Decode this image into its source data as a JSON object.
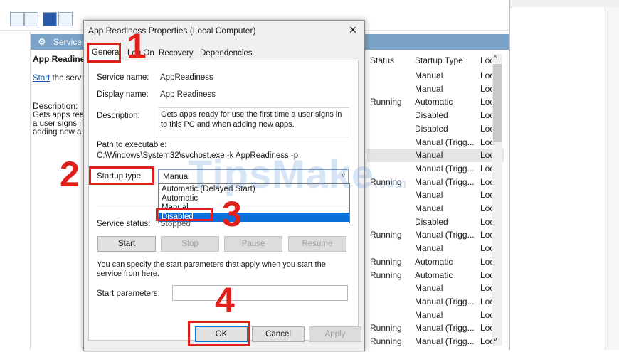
{
  "services_window": {
    "header_title": "Service",
    "service_name": "App Readine",
    "start_link": "Start",
    "start_rest": " the serv",
    "description_label": "Description:",
    "description_lines": [
      "Gets apps rea",
      "a user signs i",
      "adding new a"
    ],
    "columns": {
      "status": "Status",
      "startup": "Startup Type",
      "log": "Loc"
    },
    "rows": [
      {
        "status": "",
        "startup": "Manual",
        "log": "Loc"
      },
      {
        "status": "",
        "startup": "Manual",
        "log": "Loc"
      },
      {
        "status": "Running",
        "startup": "Automatic",
        "log": "Loc"
      },
      {
        "status": "",
        "startup": "Disabled",
        "log": "Loc"
      },
      {
        "status": "",
        "startup": "Disabled",
        "log": "Loc"
      },
      {
        "status": "",
        "startup": "Manual (Trigg...",
        "log": "Loc"
      },
      {
        "status": "",
        "startup": "Manual",
        "log": "Loc",
        "selected": true
      },
      {
        "status": "",
        "startup": "Manual (Trigg...",
        "log": "Loc"
      },
      {
        "status": "Running",
        "startup": "Manual (Trigg...",
        "log": "Loc"
      },
      {
        "status": "",
        "startup": "Manual",
        "log": "Loc"
      },
      {
        "status": "",
        "startup": "Manual",
        "log": "Loc"
      },
      {
        "status": "",
        "startup": "Disabled",
        "log": "Loc"
      },
      {
        "status": "Running",
        "startup": "Manual (Trigg...",
        "log": "Loc"
      },
      {
        "status": "",
        "startup": "Manual",
        "log": "Loc"
      },
      {
        "status": "Running",
        "startup": "Automatic",
        "log": "Loc"
      },
      {
        "status": "Running",
        "startup": "Automatic",
        "log": "Loc"
      },
      {
        "status": "",
        "startup": "Manual",
        "log": "Loc"
      },
      {
        "status": "",
        "startup": "Manual (Trigg...",
        "log": "Loc"
      },
      {
        "status": "",
        "startup": "Manual",
        "log": "Loc"
      },
      {
        "status": "Running",
        "startup": "Manual (Trigg...",
        "log": "Loc"
      },
      {
        "status": "Running",
        "startup": "Manual (Trigg...",
        "log": "Loc"
      }
    ]
  },
  "dialog": {
    "title": "App Readiness Properties (Local Computer)",
    "tabs": {
      "general": "General",
      "logon": "Log On",
      "recovery": "Recovery",
      "dependencies": "Dependencies"
    },
    "service_name_label": "Service name:",
    "service_name_value": "AppReadiness",
    "display_name_label": "Display name:",
    "display_name_value": "App Readiness",
    "description_label": "Description:",
    "description_value": "Gets apps ready for use the first time a user signs in to this PC and when adding new apps.",
    "path_label": "Path to executable:",
    "path_value": "C:\\Windows\\System32\\svchost.exe -k AppReadiness -p",
    "startup_type_label": "Startup type:",
    "startup_type_value": "Manual",
    "startup_options": [
      "Automatic (Delayed Start)",
      "Automatic",
      "Manual",
      "Disabled"
    ],
    "service_status_label": "Service status:",
    "service_status_value": "Stopped",
    "buttons": {
      "start": "Start",
      "stop": "Stop",
      "pause": "Pause",
      "resume": "Resume"
    },
    "help_text": "You can specify the start parameters that apply when you start the service from here.",
    "start_params_label": "Start parameters:",
    "ok": "OK",
    "cancel": "Cancel",
    "apply": "Apply"
  },
  "annotations": {
    "step1": "1",
    "step2": "2",
    "step3": "3",
    "step4": "4",
    "watermark": "TipsMake",
    "watermark_suffix": ".com",
    "color": "#e0201b"
  }
}
